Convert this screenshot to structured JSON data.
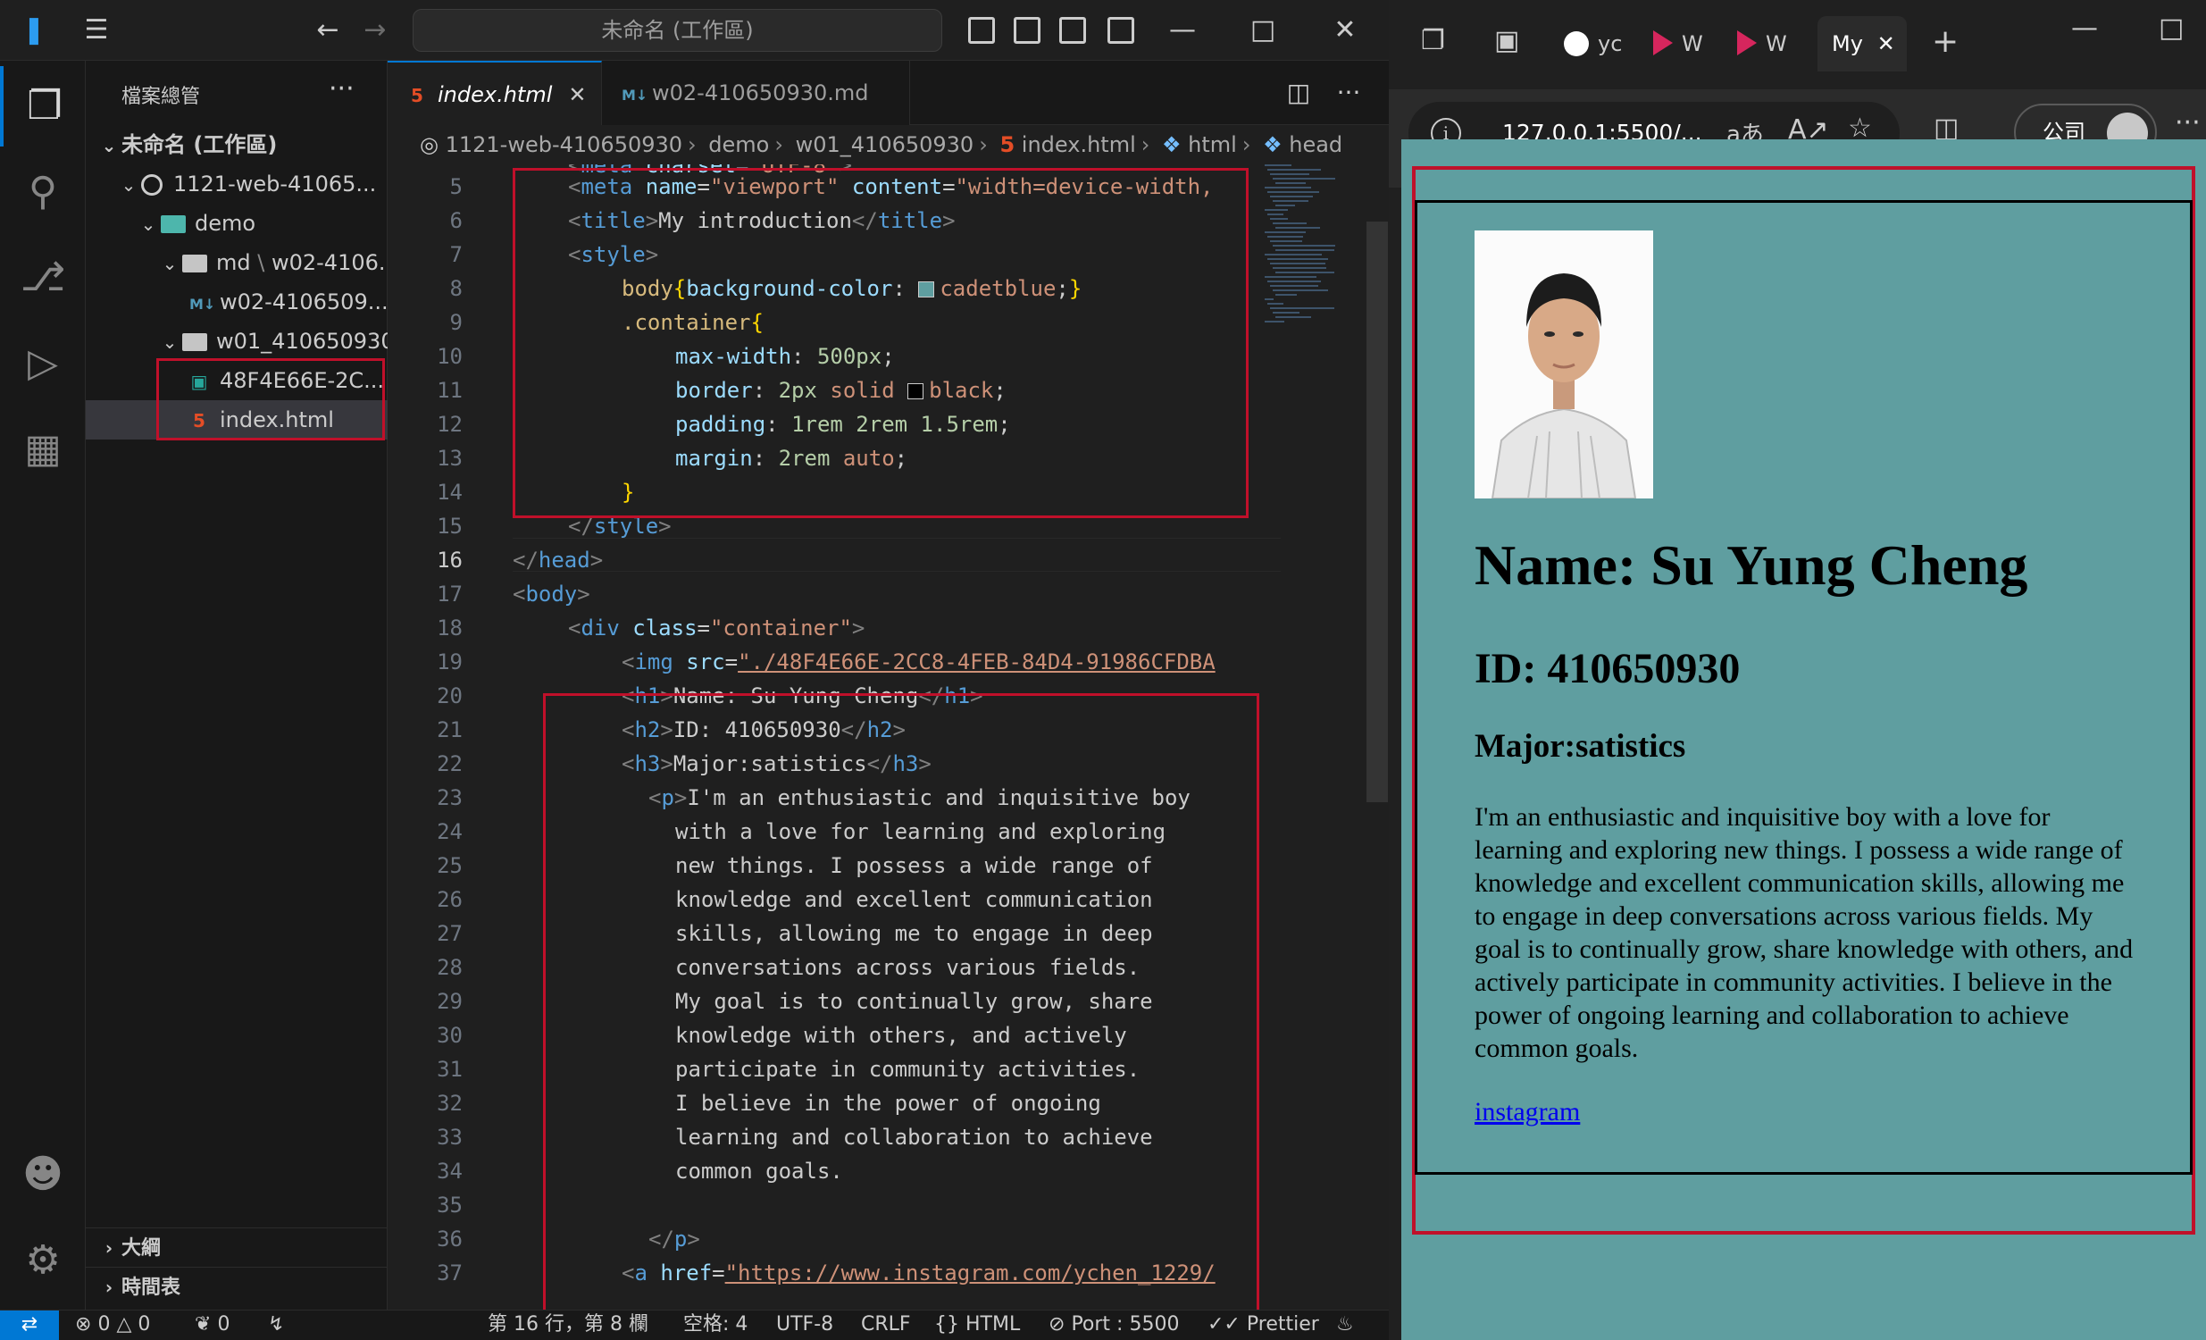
{
  "vscode": {
    "command_center": "未命名 (工作區)",
    "explorer_title": "檔案總管",
    "tree": [
      {
        "label": "未命名 (工作區)"
      },
      {
        "label": "1121-web-41065..."
      },
      {
        "label": "demo"
      },
      {
        "label": "md",
        "suffix": "w02-4106..."
      },
      {
        "label": "w02-4106509..."
      },
      {
        "label": "w01_410650930"
      },
      {
        "label": "48F4E66E-2C..."
      },
      {
        "label": "index.html"
      }
    ],
    "outline_label": "大綱",
    "timeline_label": "時間表",
    "tabs": [
      {
        "label": "index.html"
      },
      {
        "label": "w02-410650930.md"
      }
    ],
    "breadcrumb": [
      "1121-web-410650930",
      "demo",
      "w01_410650930",
      "index.html",
      "html",
      "head"
    ],
    "line_numbers": [
      "5",
      "6",
      "7",
      "8",
      "9",
      "10",
      "11",
      "12",
      "13",
      "14",
      "15",
      "16",
      "17",
      "18",
      "19",
      "20",
      "21",
      "22",
      "23",
      "24",
      "25",
      "26",
      "27",
      "28",
      "29",
      "30",
      "31",
      "32",
      "33",
      "34",
      "35",
      "36",
      "37"
    ],
    "code": {
      "l5_attr1": "name",
      "l5_str1": "\"viewport\"",
      "l5_attr2": "content",
      "l5_str2": "\"width=device-width,",
      "l6_text": "My introduction",
      "l8_prop": "background-color",
      "l8_val": "cadetblue",
      "l9_sel": ".container",
      "l10_prop": "max-width",
      "l10_val": "500px",
      "l11_prop": "border",
      "l11_num": "2px",
      "l11_kw": "solid",
      "l11_val": "black",
      "l12_prop": "padding",
      "l12_val": "1rem 2rem 1.5rem",
      "l13_prop": "margin",
      "l13_num": "2rem",
      "l13_kw": "auto",
      "l18_attr": "class",
      "l18_str": "\"container\"",
      "l19_attr": "src",
      "l19_str": "\"./48F4E66E-2CC8-4FEB-84D4-91986CFDBA",
      "l20_text": "Name: Su Yung Cheng",
      "l21_text": "ID: 410650930",
      "l22_text": "Major:satistics",
      "p_lines": [
        "I'm an enthusiastic and inquisitive boy",
        "with a love for learning and exploring",
        "new things. I possess a wide range of",
        "knowledge and excellent communication",
        "skills, allowing me to engage in deep",
        "conversations across various fields.",
        "My goal is to continually grow, share",
        "knowledge with others, and actively",
        "participate in community activities.",
        "I believe in the power of ongoing",
        "learning and collaboration to achieve",
        "common goals."
      ],
      "l37_attr": "href",
      "l37_str": "\"https://www.instagram.com/ychen_1229/"
    },
    "status": {
      "errors": "0",
      "warnings": "0",
      "ports_count": "0",
      "position": "第 16 行，第 8 欄",
      "spaces": "空格: 4",
      "encoding": "UTF-8",
      "eol": "CRLF",
      "language": "HTML",
      "port": "Port : 5500",
      "formatter": "Prettier"
    }
  },
  "browser": {
    "tabs": [
      {
        "label": "yc"
      },
      {
        "label": "W"
      },
      {
        "label": "W"
      },
      {
        "label": "My"
      }
    ],
    "url": "127.0.0.1:5500/...",
    "profile_label": "公司",
    "page": {
      "name": "Name: Su Yung Cheng",
      "id": "ID: 410650930",
      "major": "Major:satistics",
      "paragraph": "I'm an enthusiastic and inquisitive boy with a love for learning and exploring new things. I possess a wide range of knowledge and excellent communication skills, allowing me to engage in deep conversations across various fields. My goal is to continually grow, share knowledge with others, and actively participate in community activities. I believe in the power of ongoing learning and collaboration to achieve common goals.",
      "link": "instagram",
      "background": "#5f9ea0"
    }
  },
  "colors": {
    "accent": "#0078d4",
    "highlight_box": "#c0102a"
  }
}
